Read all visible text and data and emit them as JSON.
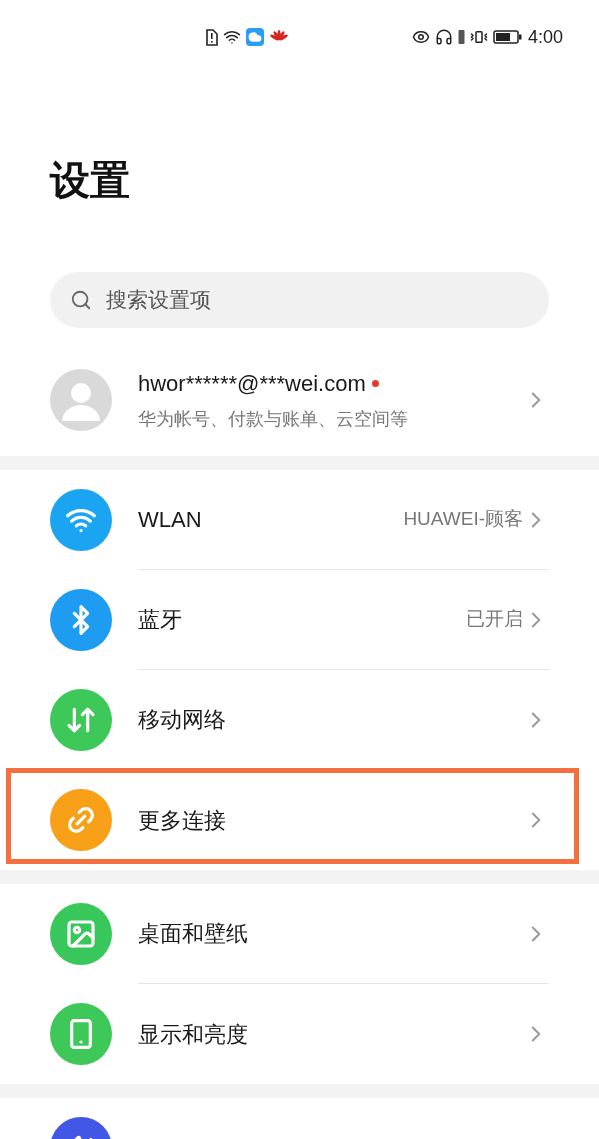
{
  "status_bar": {
    "time": "4:00"
  },
  "title": "设置",
  "search": {
    "placeholder": "搜索设置项"
  },
  "account": {
    "email": "hwor******@***wei.com",
    "subtitle": "华为帐号、付款与账单、云空间等",
    "unread": true
  },
  "groups": [
    [
      {
        "kind": "wifi",
        "color": "#1ba4f2",
        "label": "WLAN",
        "value": "HUAWEI-顾客",
        "highlighted": false
      },
      {
        "kind": "bluetooth",
        "color": "#1d9cf1",
        "label": "蓝牙",
        "value": "已开启",
        "highlighted": false
      },
      {
        "kind": "mobile",
        "color": "#3ec85a",
        "label": "移动网络",
        "highlighted": false
      },
      {
        "kind": "link",
        "color": "#f9a019",
        "label": "更多连接",
        "highlighted": true
      }
    ],
    [
      {
        "kind": "image",
        "color": "#37c75a",
        "label": "桌面和壁纸",
        "highlighted": false
      },
      {
        "kind": "display",
        "color": "#3ec85a",
        "label": "显示和亮度",
        "highlighted": false
      }
    ],
    [
      {
        "kind": "sound",
        "color": "#4357e6"
      }
    ]
  ]
}
